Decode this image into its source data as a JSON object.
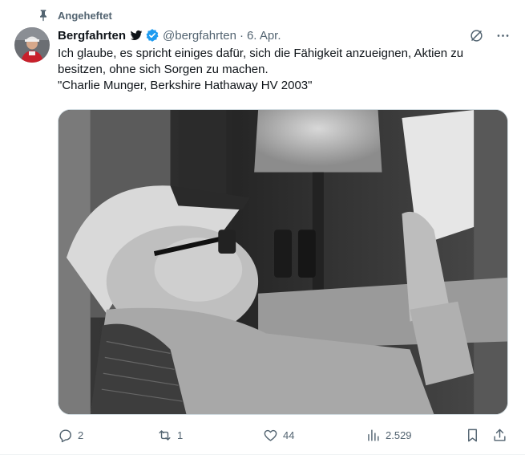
{
  "pinned_label": "Angeheftet",
  "author": {
    "name": "Bergfahrten",
    "handle": "@bergfahrten",
    "date": "6. Apr."
  },
  "tweet": {
    "lines": [
      "Ich glaube, es spricht einiges dafür, sich die Fähigkeit anzueignen, Aktien zu besitzen, ohne sich Sorgen zu machen.",
      "\"Charlie Munger, Berkshire Hathaway HV 2003\""
    ]
  },
  "media": {
    "description_icon": "black-and-white-photo"
  },
  "actions": {
    "replies": "2",
    "reposts": "1",
    "likes": "44",
    "views": "2.529"
  },
  "colors": {
    "verified": "#1d9bf0",
    "secondary_text": "#536471",
    "primary_text": "#0f1419"
  }
}
